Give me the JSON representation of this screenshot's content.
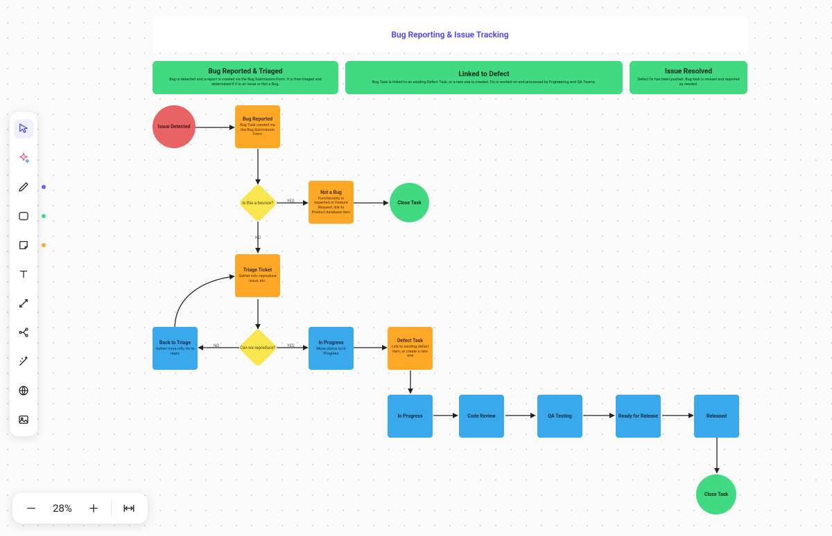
{
  "diagram": {
    "title": "Bug Reporting & Issue Tracking",
    "lanes": [
      {
        "title": "Bug Reported & Triaged",
        "sub": "Bug is detected and a report is created via the Bug Submission Form. It is then triaged and determined if it is an issue or Not a Bug."
      },
      {
        "title": "Linked to Defect",
        "sub": "Bug Task is linked to an existing Defect Task, or a new one is created. Fix is worked on and processed by Engineering and QA Teams."
      },
      {
        "title": "Issue Resolved",
        "sub": "Defect fix has been pushed. Bug task is revised and reported as needed."
      }
    ],
    "nodes": {
      "issue_detected": {
        "title": "Issue Detected"
      },
      "bug_reported": {
        "title": "Bug Reported",
        "sub": "Bug Task created via the Bug Submission Form"
      },
      "dec_bounce": {
        "title": "Is this a bounce?"
      },
      "not_a_bug": {
        "title": "Not a Bug",
        "sub": "Functionality is expected or Feature Request, link to Product database item"
      },
      "close_task_1": {
        "title": "Close Task"
      },
      "triage_ticket": {
        "title": "Triage Ticket",
        "sub": "Gather info; reproduce issue, etc."
      },
      "back_to_triage": {
        "title": "Back to Triage",
        "sub": "Gather more info; try to repro"
      },
      "dec_reproduce": {
        "title": "Can we reproduce?"
      },
      "in_progress_1": {
        "title": "In Progress",
        "sub": "Move status to In Progress"
      },
      "defect_task": {
        "title": "Defect Task",
        "sub": "Link to existing defect item, or create a new one"
      },
      "in_progress_2": {
        "title": "In Progress"
      },
      "code_review": {
        "title": "Code Review"
      },
      "qa_testing": {
        "title": "QA Testing"
      },
      "ready_release": {
        "title": "Ready for Release"
      },
      "released": {
        "title": "Released"
      },
      "close_task_2": {
        "title": "Close Task"
      }
    },
    "edge_labels": {
      "yes": "YES",
      "no": "NO"
    }
  },
  "toolbar": {
    "zoom_label": "28%"
  }
}
